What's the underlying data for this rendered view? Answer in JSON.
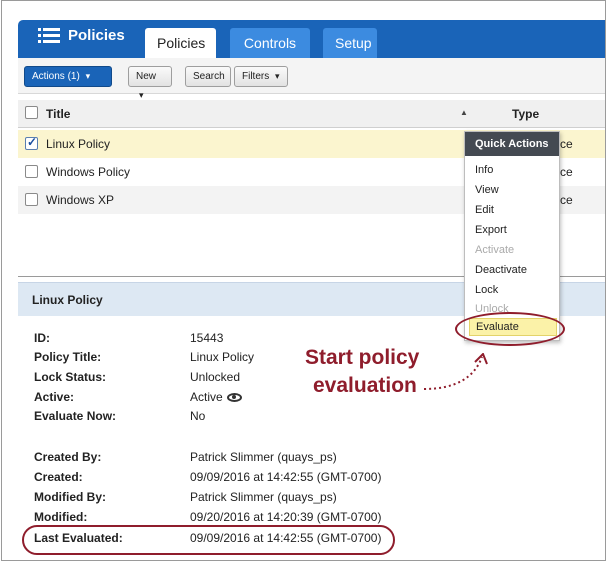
{
  "nav": {
    "brand": "Policies",
    "tabs": [
      {
        "label": "Policies",
        "active": true
      },
      {
        "label": "Controls",
        "active": false
      },
      {
        "label": "Setup",
        "active": false
      }
    ]
  },
  "toolbar": {
    "actions_label": "Actions (1)",
    "new_label": "New",
    "search_label": "Search",
    "filters_label": "Filters"
  },
  "list": {
    "columns": {
      "title": "Title",
      "type": "Type"
    },
    "rows": [
      {
        "title": "Linux Policy",
        "type_fragment": "ce",
        "checked": true
      },
      {
        "title": "Windows Policy",
        "type_fragment": "ce",
        "checked": false
      },
      {
        "title": "Windows XP",
        "type_fragment": "ce",
        "checked": false
      }
    ]
  },
  "quick_actions": {
    "title": "Quick Actions",
    "items": [
      {
        "label": "Info",
        "enabled": true
      },
      {
        "label": "View",
        "enabled": true
      },
      {
        "label": "Edit",
        "enabled": true
      },
      {
        "label": "Export",
        "enabled": true
      },
      {
        "label": "Activate",
        "enabled": false
      },
      {
        "label": "Deactivate",
        "enabled": true
      },
      {
        "label": "Lock",
        "enabled": true
      },
      {
        "label": "Unlock",
        "enabled": false
      },
      {
        "label": "Evaluate",
        "enabled": true,
        "highlighted": true
      }
    ]
  },
  "detail": {
    "title": "Linux Policy",
    "fields": [
      {
        "label": "ID:",
        "value": "15443"
      },
      {
        "label": "Policy Title:",
        "value": "Linux Policy"
      },
      {
        "label": "Lock Status:",
        "value": "Unlocked"
      },
      {
        "label": "Active:",
        "value": "Active"
      },
      {
        "label": "Evaluate Now:",
        "value": "No"
      },
      {
        "label": "Created By:",
        "value": "Patrick Slimmer (quays_ps)"
      },
      {
        "label": "Created:",
        "value": "09/09/2016 at 14:42:55 (GMT-0700)"
      },
      {
        "label": "Modified By:",
        "value": "Patrick Slimmer (quays_ps)"
      },
      {
        "label": "Modified:",
        "value": "09/20/2016 at 14:20:39 (GMT-0700)"
      },
      {
        "label": "Last Evaluated:",
        "value": "09/09/2016 at 14:42:55 (GMT-0700)"
      }
    ]
  },
  "annotation": {
    "line1": "Start policy",
    "line2": "evaluation",
    "color": "#8f1d2c"
  },
  "colors": {
    "nav_blue": "#1a64b8",
    "selected_row": "#fbf5cf",
    "detail_header": "#dde8f3",
    "menu_header": "#444a52"
  }
}
